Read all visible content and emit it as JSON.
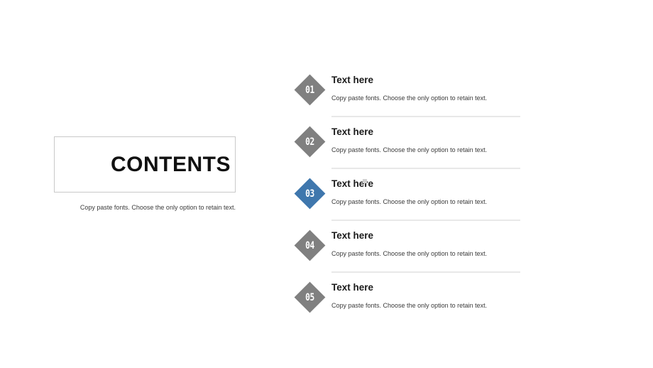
{
  "left": {
    "title": "CONTENTS",
    "subtitle": "Copy paste fonts. Choose the only option to retain text."
  },
  "colors": {
    "gray_diamond": "#808080",
    "blue_diamond": "#3f77ad",
    "divider": "#e8e8e8",
    "box_border": "#c9c9c9",
    "bullet": "#d2d2d2",
    "title_text": "#111111",
    "body_text": "#3b3b3b"
  },
  "list": {
    "items": [
      {
        "number": "01",
        "title": "Text here",
        "description": "Copy paste fonts. Choose the only option to retain text.",
        "color": "#808080",
        "highlighted": false,
        "has_divider": true,
        "has_bullet": false
      },
      {
        "number": "02",
        "title": "Text here",
        "description": "Copy paste fonts. Choose the only option to retain text.",
        "color": "#808080",
        "highlighted": false,
        "has_divider": true,
        "has_bullet": false
      },
      {
        "number": "03",
        "title": "Text here",
        "description": "Copy paste fonts. Choose the only option to retain text.",
        "color": "#3f77ad",
        "highlighted": true,
        "has_divider": true,
        "has_bullet": true
      },
      {
        "number": "04",
        "title": "Text here",
        "description": "Copy paste fonts. Choose the only option to retain text.",
        "color": "#808080",
        "highlighted": false,
        "has_divider": true,
        "has_bullet": false
      },
      {
        "number": "05",
        "title": "Text here",
        "description": "Copy paste fonts. Choose the only option to retain text.",
        "color": "#808080",
        "highlighted": false,
        "has_divider": false,
        "has_bullet": false
      }
    ]
  }
}
